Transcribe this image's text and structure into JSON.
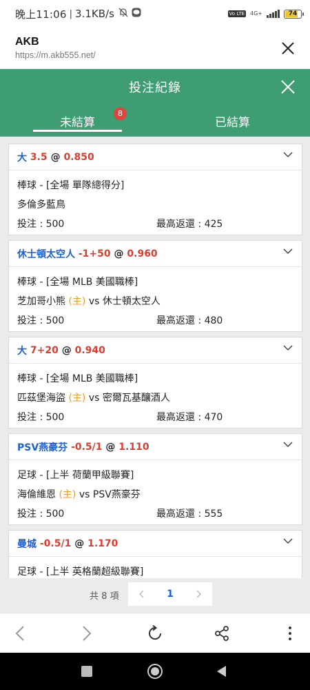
{
  "status_bar": {
    "time": "晚上11:06",
    "net_speed": "3.1KB/s",
    "volte_label": "Vo LTE",
    "network_label": "4G+",
    "battery_level": "74"
  },
  "browser": {
    "site_title": "AKB",
    "url": "https://m.akb555.net/"
  },
  "modal": {
    "title": "投注紀錄",
    "tabs": [
      {
        "label": "未結算",
        "badge": "8",
        "active": true
      },
      {
        "label": "已結算",
        "active": false
      }
    ]
  },
  "bets": [
    {
      "selection": "大",
      "handicap": "3.5",
      "at": "@",
      "odds": "0.850",
      "league": "棒球 - [全場 單隊總得分]",
      "team1": "多倫多藍鳥",
      "home_mark": "",
      "vs": "",
      "team2": "",
      "stake_label": "投注 : 500",
      "return_label": "最高返還 : 425"
    },
    {
      "selection": "休士頓太空人",
      "handicap": "-1+50",
      "at": "@",
      "odds": "0.960",
      "league": "棒球 - [全場 MLB 美國職棒]",
      "team1": "芝加哥小熊",
      "home_mark": "(主)",
      "vs": "vs",
      "team2": "休士頓太空人",
      "stake_label": "投注 : 500",
      "return_label": "最高返還 : 480"
    },
    {
      "selection": "大",
      "handicap": "7+20",
      "at": "@",
      "odds": "0.940",
      "league": "棒球 - [全場 MLB 美國職棒]",
      "team1": "匹茲堡海盜",
      "home_mark": "(主)",
      "vs": "vs",
      "team2": "密爾瓦基釀酒人",
      "stake_label": "投注 : 500",
      "return_label": "最高返還 : 470"
    },
    {
      "selection": "PSV燕豪芬",
      "handicap": "-0.5/1",
      "at": "@",
      "odds": "1.110",
      "league": "足球 - [上半 荷蘭甲級聯賽]",
      "team1": "海倫維恩",
      "home_mark": "(主)",
      "vs": "vs",
      "team2": "PSV燕豪芬",
      "stake_label": "投注 : 500",
      "return_label": "最高返還 : 555"
    },
    {
      "selection": "曼城",
      "handicap": "-0.5/1",
      "at": "@",
      "odds": "1.170",
      "league": "足球 - [上半 英格蘭超級聯賽]"
    }
  ],
  "pager": {
    "total": "共 8 項",
    "current_page": "1"
  },
  "colors": {
    "header_green": "#3e9d72",
    "selection_blue": "#1d5fd0",
    "odds_red": "#e23b2e",
    "home_orange": "#e89a2c",
    "badge_red": "#e0443e"
  }
}
